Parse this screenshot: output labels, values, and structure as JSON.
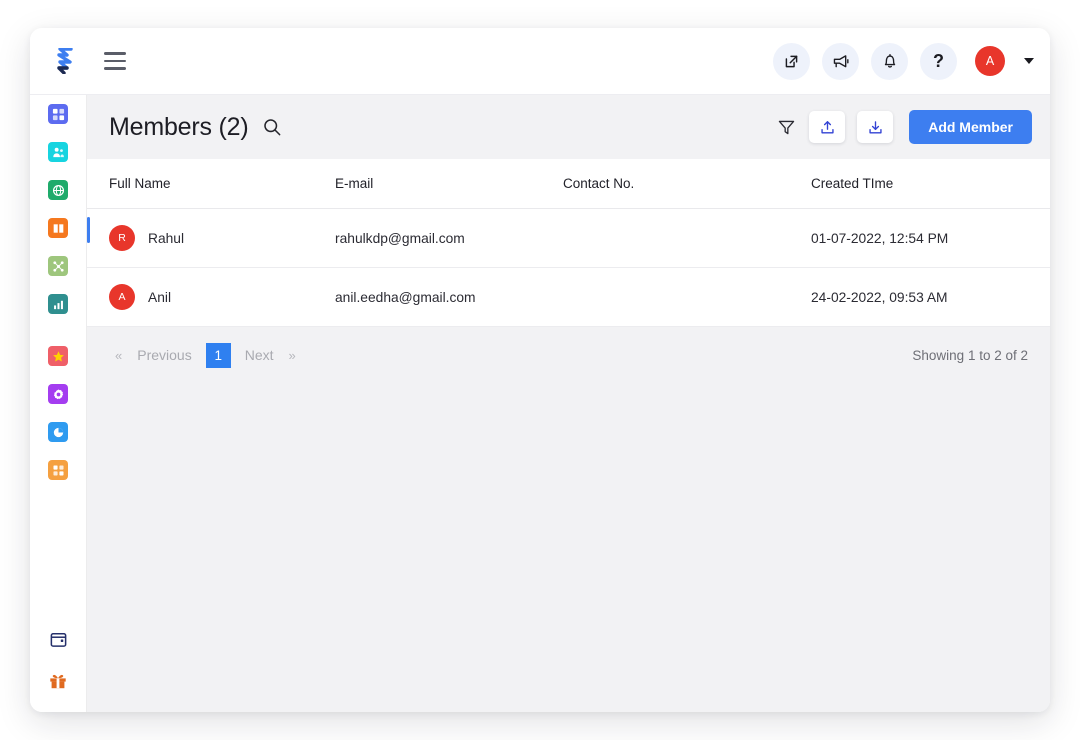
{
  "app": {
    "logo_icon": "lightning-logo-icon",
    "menu_icon": "hamburger-menu-icon"
  },
  "topbar": {
    "icons": [
      {
        "name": "external-link-icon",
        "label": "Open external"
      },
      {
        "name": "megaphone-icon",
        "label": "Announcements"
      },
      {
        "name": "bell-icon",
        "label": "Notifications"
      },
      {
        "name": "question-mark-icon",
        "label": "?"
      }
    ],
    "help_label": "?",
    "avatar_initial": "A",
    "avatar_color": "#e8362b",
    "caret_icon": "chevron-down-icon"
  },
  "sidebar": {
    "items": [
      {
        "name": "dashboard",
        "icon": "grid-dashboard-icon",
        "color": "#5c6bf0"
      },
      {
        "name": "members",
        "icon": "members-group-icon",
        "color": "#17d4e0",
        "active": true
      },
      {
        "name": "network",
        "icon": "globe-network-icon",
        "color": "#1fab6b"
      },
      {
        "name": "library",
        "icon": "open-book-icon",
        "color": "#f5781f"
      },
      {
        "name": "share",
        "icon": "share-nodes-icon",
        "color": "#9ec67d"
      },
      {
        "name": "reports",
        "icon": "bar-chart-icon",
        "color": "#2f8f8f"
      },
      {
        "name": "favorites",
        "icon": "star-icon",
        "color": "#ef5f68"
      },
      {
        "name": "settings",
        "icon": "gear-icon",
        "color": "#a43df0"
      },
      {
        "name": "analytics",
        "icon": "pie-chart-icon",
        "color": "#2f9bf0"
      },
      {
        "name": "apps",
        "icon": "apps-grid-icon",
        "color": "#f5a040"
      }
    ],
    "bottom_items": [
      {
        "name": "calendar",
        "icon": "calendar-icon",
        "color": "#25306b"
      },
      {
        "name": "rewards",
        "icon": "gift-icon",
        "color": "#e06a20"
      }
    ],
    "accent_color": "#3d7ef0"
  },
  "page": {
    "title": "Members (2)",
    "search_icon": "search-icon",
    "actions": {
      "filter_icon": "filter-funnel-icon",
      "import_icon": "upload-icon",
      "export_icon": "download-icon",
      "add_label": "Add Member",
      "add_color": "#3d7ef0"
    }
  },
  "table": {
    "columns": [
      "Full Name",
      "E-mail",
      "Contact No.",
      "Created TIme"
    ],
    "rows": [
      {
        "initial": "R",
        "full_name": "Rahul",
        "email": "rahulkdp@gmail.com",
        "contact": "",
        "created_time": "01-07-2022, 12:54 PM"
      },
      {
        "initial": "A",
        "full_name": "Anil",
        "email": "anil.eedha@gmail.com",
        "contact": "",
        "created_time": "24-02-2022, 09:53 AM"
      }
    ]
  },
  "pagination": {
    "first_chevron": "«",
    "previous_label": "Previous",
    "current_page": "1",
    "next_label": "Next",
    "last_chevron": "»",
    "showing_text": "Showing 1 to 2 of 2",
    "active_color": "#2f80f0"
  }
}
